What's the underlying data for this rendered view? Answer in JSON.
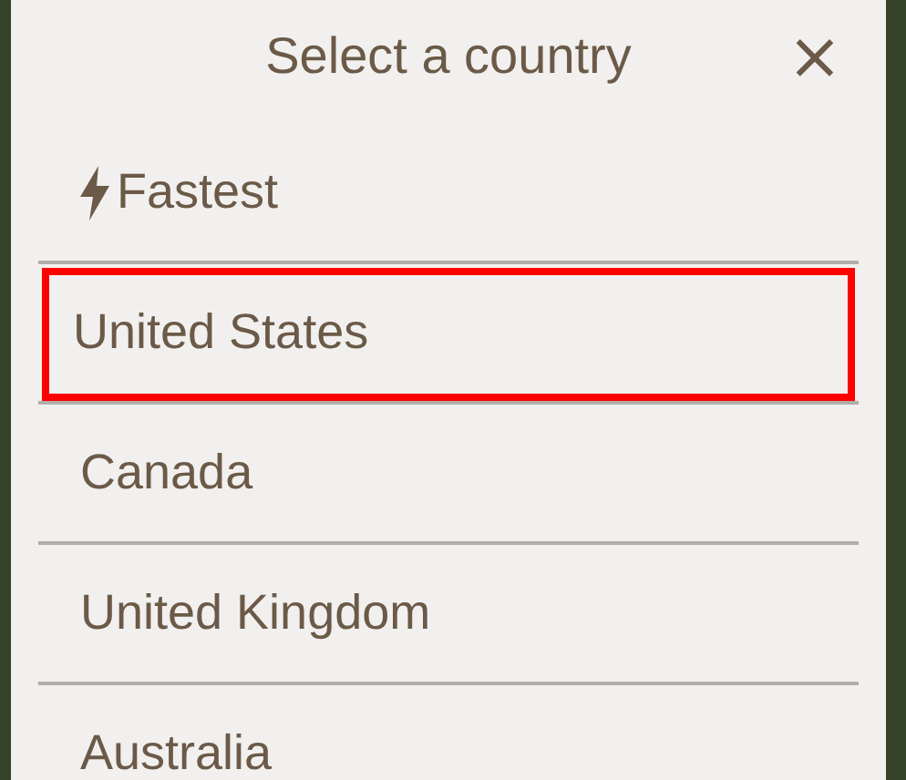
{
  "dialog": {
    "title": "Select a country",
    "close": "×"
  },
  "countries": [
    {
      "label": "Fastest",
      "kind": "fastest",
      "selected": false
    },
    {
      "label": "United States",
      "kind": "country",
      "selected": true
    },
    {
      "label": "Canada",
      "kind": "country",
      "selected": false
    },
    {
      "label": "United Kingdom",
      "kind": "country",
      "selected": false
    },
    {
      "label": "Australia",
      "kind": "country",
      "selected": false
    }
  ]
}
